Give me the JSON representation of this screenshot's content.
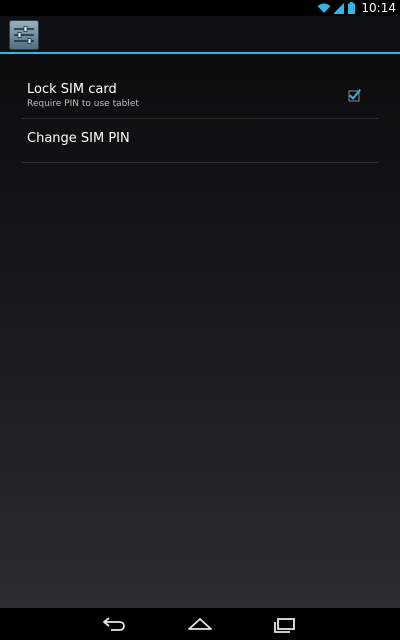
{
  "status_bar": {
    "time": "10:14",
    "icons": [
      "wifi-icon",
      "signal-icon",
      "battery-icon"
    ]
  },
  "action_bar": {
    "icon": "settings-sliders-icon",
    "accent_color": "#33b5e5"
  },
  "preferences": [
    {
      "title": "Lock SIM card",
      "summary": "Require PIN to use tablet",
      "checked": true
    },
    {
      "title": "Change SIM PIN"
    }
  ],
  "navigation": {
    "buttons": [
      "back-icon",
      "home-icon",
      "recents-icon"
    ]
  }
}
